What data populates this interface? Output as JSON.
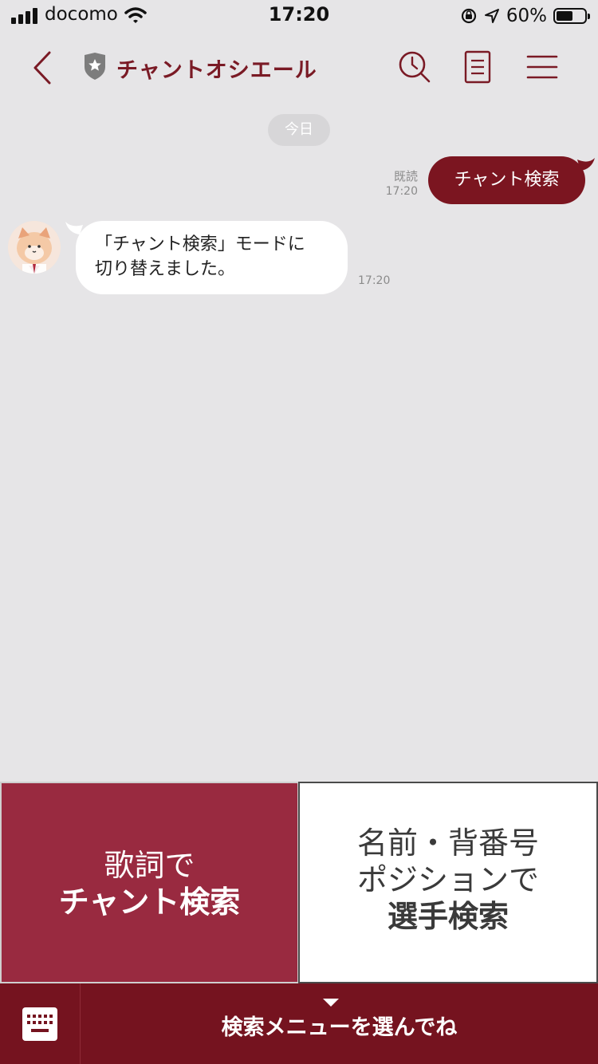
{
  "status_bar": {
    "carrier": "docomo",
    "time": "17:20",
    "battery_text": "60%",
    "battery_level": 0.6
  },
  "header": {
    "title": "チャントオシエール"
  },
  "chat": {
    "date_divider": "今日",
    "messages": [
      {
        "from": "me",
        "text": "チャント検索",
        "read": "既読",
        "time": "17:20"
      },
      {
        "from": "bot",
        "lines": [
          "「チャント検索」モードに",
          "切り替えました。"
        ],
        "time": "17:20"
      }
    ]
  },
  "rich_menu": {
    "left": {
      "line1": "歌詞で",
      "line2": "チャント検索"
    },
    "right": {
      "line1": "名前・背番号",
      "line2": "ポジションで",
      "line3": "選手検索"
    }
  },
  "bottom_bar": {
    "menu_label": "検索メニューを選んでね"
  },
  "colors": {
    "brand": "#7b1520",
    "menu_left": "#992a40",
    "bottom_bar": "#75131f",
    "background": "#e6e5e7"
  }
}
